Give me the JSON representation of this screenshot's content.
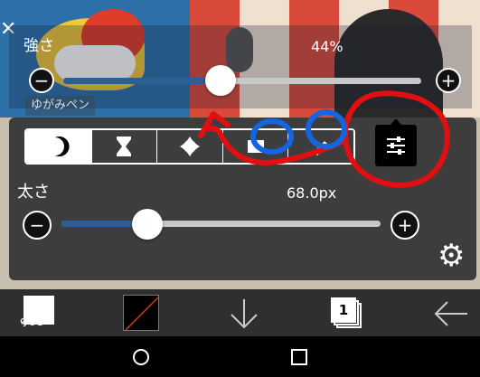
{
  "strength": {
    "label": "強さ",
    "value_text": "44%",
    "value": 0.44,
    "pen_name": "ゆがみペン"
  },
  "brush_tabs": [
    {
      "name": "moon-icon",
      "active": true
    },
    {
      "name": "hourglass-icon",
      "active": false
    },
    {
      "name": "blob-icon",
      "active": false
    },
    {
      "name": "smudge-icon",
      "active": false
    },
    {
      "name": "eraser-icon",
      "active": false
    }
  ],
  "settings_tab": {
    "name": "sliders-icon",
    "active": true
  },
  "thickness": {
    "label": "太さ",
    "value_text": "68.0px",
    "value": 0.27
  },
  "toolbar": {
    "brush_size": "68"
  },
  "colors": {
    "track_fill": "#2e5f94",
    "panel": "#3d3d3d",
    "annotation_red": "#e01010",
    "annotation_blue": "#1565e0"
  }
}
